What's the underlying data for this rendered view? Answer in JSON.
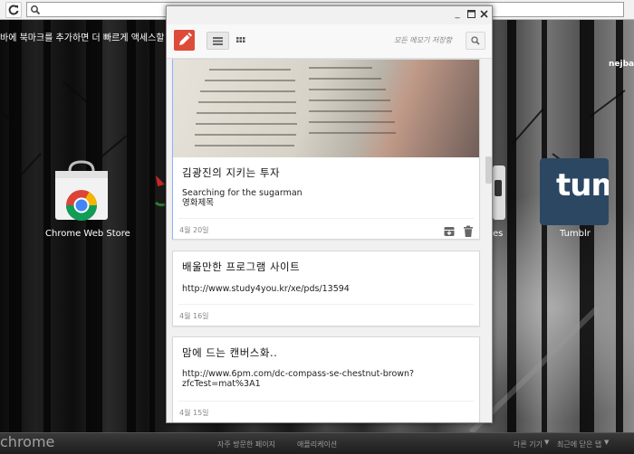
{
  "browser": {
    "bookmark_bar_hint": "바에 북마크를 추가하면 더 빠르게 액세스할 수 있",
    "user_name": "nejba",
    "brand": "chrome",
    "bottom_links": {
      "most_visited": "자주 방문한 페이지",
      "apps": "애플리케이션",
      "other_devices": "다른 기기",
      "recently_closed": "최근에 닫은 탭"
    },
    "apps": [
      {
        "name": "Chrome Web Store",
        "icon": "chrome-web-store-icon"
      },
      {
        "name": "es",
        "icon": "app-icon-partial"
      },
      {
        "name": "Tumblr",
        "icon": "tumblr-icon",
        "icon_text": "tum",
        "color": "#2c4762"
      }
    ]
  },
  "keep": {
    "toolbar": {
      "search_placeholder": "모든 메모기 저장함",
      "accent_color": "#dd4b39"
    },
    "notes": [
      {
        "title": "김광진의 지키는 투자",
        "body_lines": [
          "Searching for the sugarman",
          "영화제목"
        ],
        "date": "4월 20일",
        "has_image": true
      },
      {
        "title": "배울만한 프로그램 사이트",
        "body_lines": [
          "http://www.study4you.kr/xe/pds/13594"
        ],
        "date": "4월 16일",
        "has_image": false
      },
      {
        "title": "맘에 드는 캔버스화..",
        "body_lines": [
          "http://www.6pm.com/dc-compass-se-chestnut-brown?",
          "zfcTest=mat%3A1"
        ],
        "date": "4월 15일",
        "has_image": false
      }
    ]
  }
}
